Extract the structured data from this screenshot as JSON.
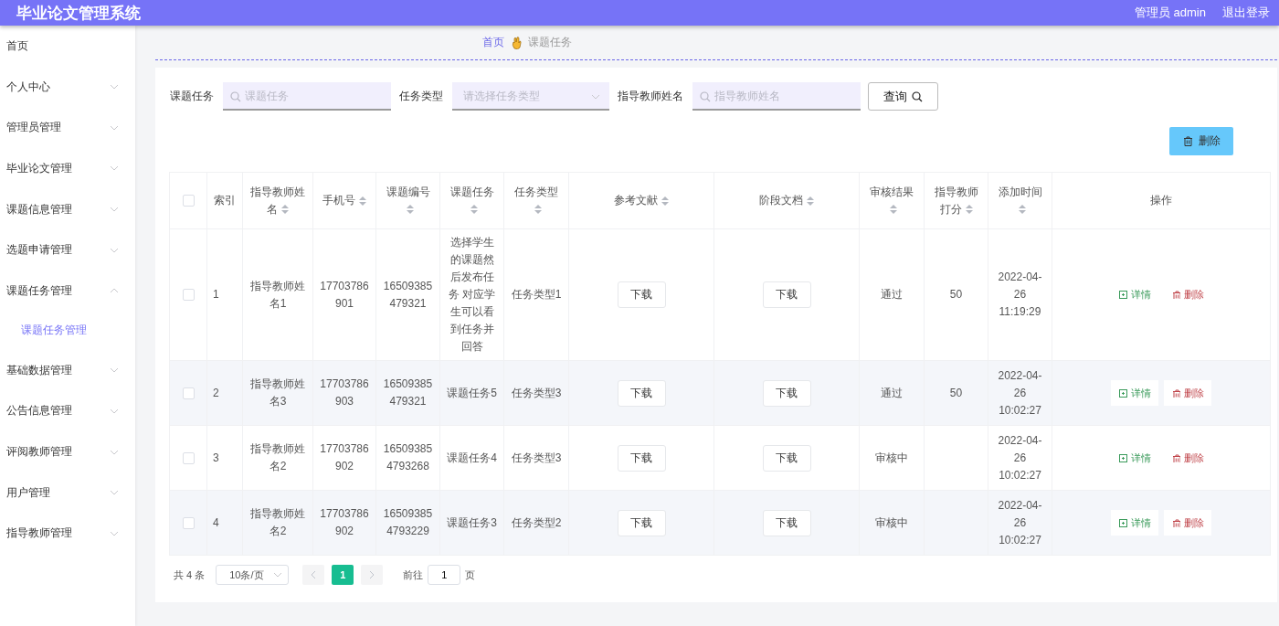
{
  "header": {
    "title": "毕业论文管理系统",
    "user": "管理员 admin",
    "logout": "退出登录"
  },
  "sidebar": {
    "items": [
      {
        "label": "首页",
        "kind": "link"
      },
      {
        "label": "个人中心",
        "kind": "submenu",
        "expanded": false
      },
      {
        "label": "管理员管理",
        "kind": "submenu",
        "expanded": false
      },
      {
        "label": "毕业论文管理",
        "kind": "submenu",
        "expanded": false
      },
      {
        "label": "课题信息管理",
        "kind": "submenu",
        "expanded": false
      },
      {
        "label": "选题申请管理",
        "kind": "submenu",
        "expanded": false
      },
      {
        "label": "课题任务管理",
        "kind": "submenu",
        "expanded": true,
        "children": [
          {
            "label": "课题任务管理",
            "selected": true
          }
        ]
      },
      {
        "label": "基础数据管理",
        "kind": "submenu",
        "expanded": false
      },
      {
        "label": "公告信息管理",
        "kind": "submenu",
        "expanded": false
      },
      {
        "label": "评阅教师管理",
        "kind": "submenu",
        "expanded": false
      },
      {
        "label": "用户管理",
        "kind": "submenu",
        "expanded": false
      },
      {
        "label": "指导教师管理",
        "kind": "submenu",
        "expanded": false
      }
    ]
  },
  "breadcrumb": [
    {
      "label": "首页",
      "selected": true
    },
    {
      "label": "课题任务",
      "selected": false
    }
  ],
  "search": {
    "fields": [
      {
        "label": "课题任务",
        "kind": "text",
        "placeholder": "课题任务"
      },
      {
        "label": "任务类型",
        "kind": "select",
        "placeholder": "请选择任务类型"
      },
      {
        "label": "指导教师姓名",
        "kind": "text",
        "placeholder": "指导教师姓名"
      }
    ],
    "button": "查询"
  },
  "delete_button": "删除",
  "table": {
    "select_all": {
      "checked": false
    },
    "columns": [
      {
        "label": "索引",
        "sortable": false
      },
      {
        "label": "指导教师姓名",
        "sortable": true
      },
      {
        "label": "手机号",
        "sortable": true
      },
      {
        "label": "课题编号",
        "sortable": true
      },
      {
        "label": "课题任务",
        "sortable": true
      },
      {
        "label": "任务类型",
        "sortable": true
      },
      {
        "label": "参考文献",
        "sortable": true
      },
      {
        "label": "阶段文档",
        "sortable": true
      },
      {
        "label": "审核结果",
        "sortable": true
      },
      {
        "label": "指导教师打分",
        "sortable": true
      },
      {
        "label": "添加时间",
        "sortable": true
      },
      {
        "label": "操作",
        "sortable": false
      }
    ],
    "rows": [
      {
        "checked": false,
        "index": "1",
        "teacher": "指导教师姓名1",
        "phone": "17703786901",
        "code": "16509385479321",
        "task": "选择学生的课题然后发布任务 对应学生可以看到任务并回答",
        "type": "任务类型1",
        "reference": "下载",
        "document": "下载",
        "result": "通过",
        "score": "50",
        "time": "2022-04-26 11:19:29",
        "actions": [
          {
            "label": "详情",
            "kind": "detail"
          },
          {
            "label": "删除",
            "kind": "delete"
          }
        ]
      },
      {
        "checked": false,
        "index": "2",
        "teacher": "指导教师姓名3",
        "phone": "17703786903",
        "code": "16509385479321",
        "task": "课题任务5",
        "type": "任务类型3",
        "reference": "下载",
        "document": "下载",
        "result": "通过",
        "score": "50",
        "time": "2022-04-26 10:02:27",
        "actions": [
          {
            "label": "详情",
            "kind": "detail"
          },
          {
            "label": "删除",
            "kind": "delete"
          }
        ]
      },
      {
        "checked": false,
        "index": "3",
        "teacher": "指导教师姓名2",
        "phone": "17703786902",
        "code": "165093854793268",
        "task": "课题任务4",
        "type": "任务类型3",
        "reference": "下载",
        "document": "下载",
        "result": "审核中",
        "time": "2022-04-26 10:02:27",
        "actions": [
          {
            "label": "详情",
            "kind": "detail"
          },
          {
            "label": "删除",
            "kind": "delete"
          }
        ]
      },
      {
        "checked": false,
        "index": "4",
        "teacher": "指导教师姓名2",
        "phone": "17703786902",
        "code": "165093854793229",
        "task": "课题任务3",
        "type": "任务类型2",
        "reference": "下载",
        "document": "下载",
        "result": "审核中",
        "time": "2022-04-26 10:02:27",
        "actions": [
          {
            "label": "详情",
            "kind": "detail"
          },
          {
            "label": "删除",
            "kind": "delete"
          }
        ]
      }
    ]
  },
  "pagination": {
    "total": "共 4 条",
    "page_size": "10条/页",
    "pages": [
      {
        "label": "1",
        "selected": true
      }
    ],
    "goto_label": "前往",
    "goto_value": "1",
    "goto_unit": "页"
  }
}
